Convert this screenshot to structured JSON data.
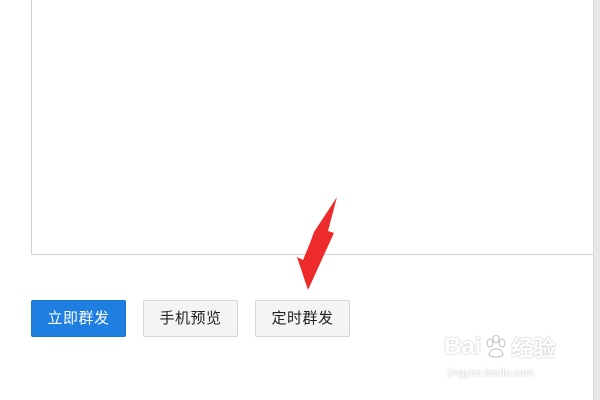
{
  "actions": {
    "send_now_label": "立即群发",
    "mobile_preview_label": "手机预览",
    "scheduled_send_label": "定时群发"
  },
  "colors": {
    "primary": "#1e7fe0",
    "secondary_bg": "#f4f4f4",
    "annotation_arrow": "#ee2b2b"
  },
  "watermark": {
    "logo_text": "Bai",
    "logo_cn": "经验",
    "url": "jingyan.baidu.com"
  },
  "icons": {
    "annotation": "arrow-pointer-icon",
    "watermark": "baidu-paw-icon"
  }
}
